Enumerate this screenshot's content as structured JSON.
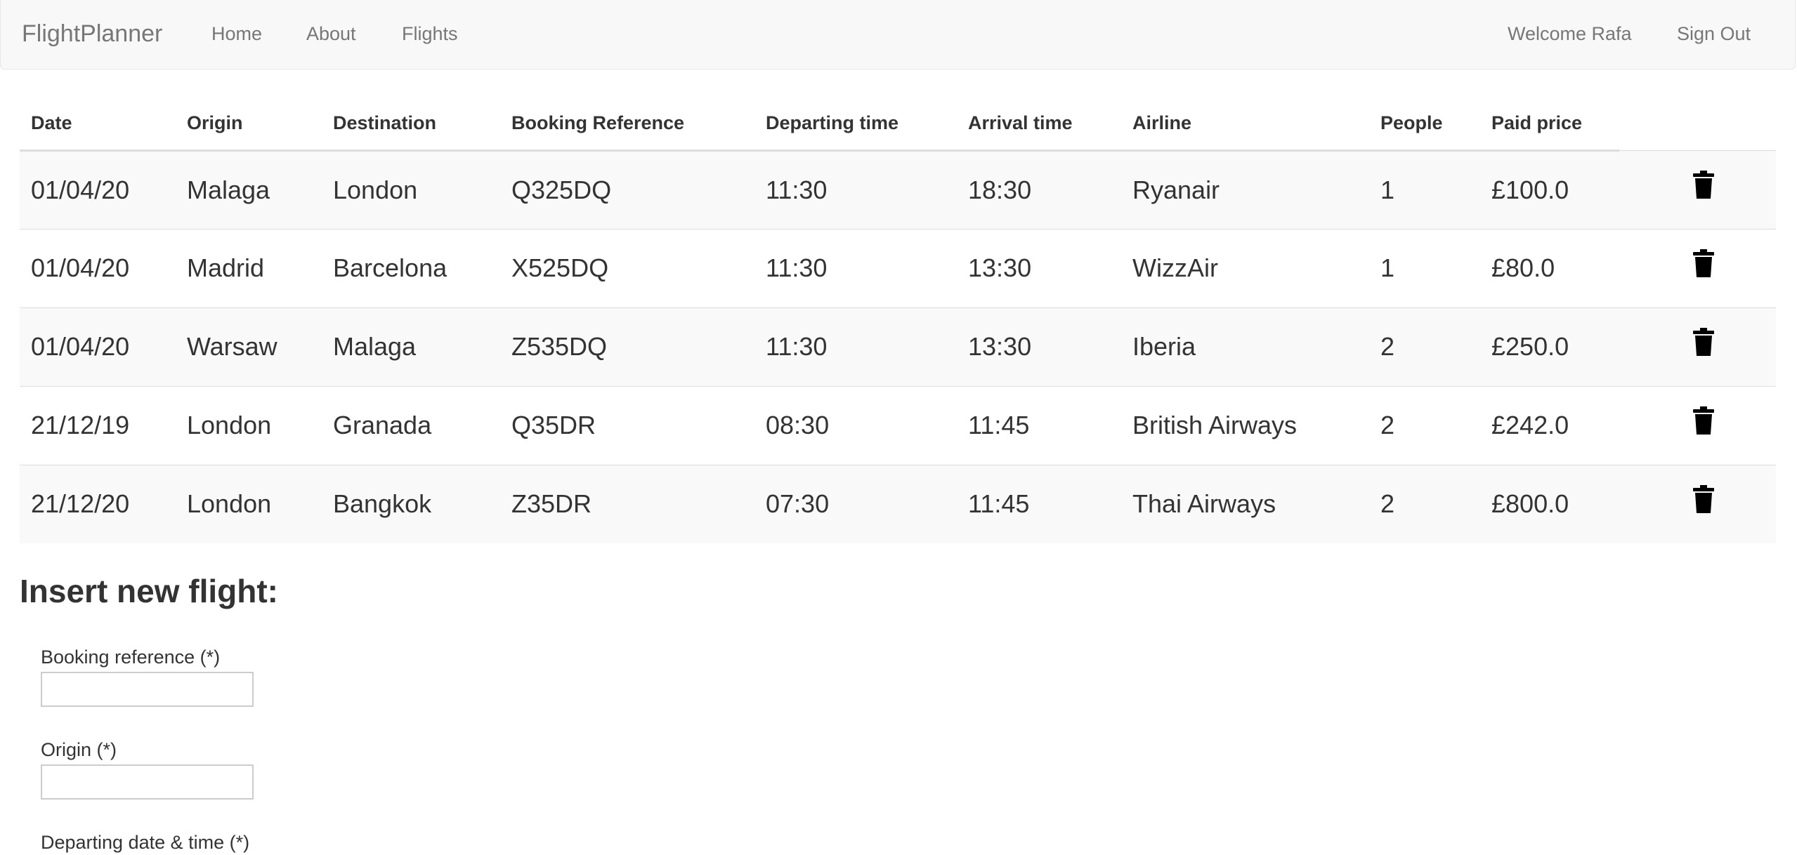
{
  "navbar": {
    "brand": "FlightPlanner",
    "links": [
      {
        "label": "Home"
      },
      {
        "label": "About"
      },
      {
        "label": "Flights"
      }
    ],
    "welcome": "Welcome Rafa",
    "sign_out": "Sign Out"
  },
  "table": {
    "headers": [
      "Date",
      "Origin",
      "Destination",
      "Booking Reference",
      "Departing time",
      "Arrival time",
      "Airline",
      "People",
      "Paid price"
    ],
    "rows": [
      {
        "date": "01/04/20",
        "origin": "Malaga",
        "destination": "London",
        "booking_reference": "Q325DQ",
        "departing_time": "11:30",
        "arrival_time": "18:30",
        "airline": "Ryanair",
        "people": "1",
        "paid_price": "£100.0"
      },
      {
        "date": "01/04/20",
        "origin": "Madrid",
        "destination": "Barcelona",
        "booking_reference": "X525DQ",
        "departing_time": "11:30",
        "arrival_time": "13:30",
        "airline": "WizzAir",
        "people": "1",
        "paid_price": "£80.0"
      },
      {
        "date": "01/04/20",
        "origin": "Warsaw",
        "destination": "Malaga",
        "booking_reference": "Z535DQ",
        "departing_time": "11:30",
        "arrival_time": "13:30",
        "airline": "Iberia",
        "people": "2",
        "paid_price": "£250.0"
      },
      {
        "date": "21/12/19",
        "origin": "London",
        "destination": "Granada",
        "booking_reference": "Q35DR",
        "departing_time": "08:30",
        "arrival_time": "11:45",
        "airline": "British Airways",
        "people": "2",
        "paid_price": "£242.0"
      },
      {
        "date": "21/12/20",
        "origin": "London",
        "destination": "Bangkok",
        "booking_reference": "Z35DR",
        "departing_time": "07:30",
        "arrival_time": "11:45",
        "airline": "Thai Airways",
        "people": "2",
        "paid_price": "£800.0"
      }
    ],
    "delete_icon": "trash-icon"
  },
  "form": {
    "title": "Insert new flight:",
    "booking_reference_label": "Booking reference (*)",
    "booking_reference_value": "",
    "origin_label": "Origin (*)",
    "origin_value": "",
    "departing_label": "Departing date & time (*)"
  },
  "colors": {
    "navbar_bg": "#f8f8f8",
    "nav_text": "#777777",
    "text": "#333333",
    "stripe": "#f9f9f9",
    "border": "#dddddd"
  }
}
